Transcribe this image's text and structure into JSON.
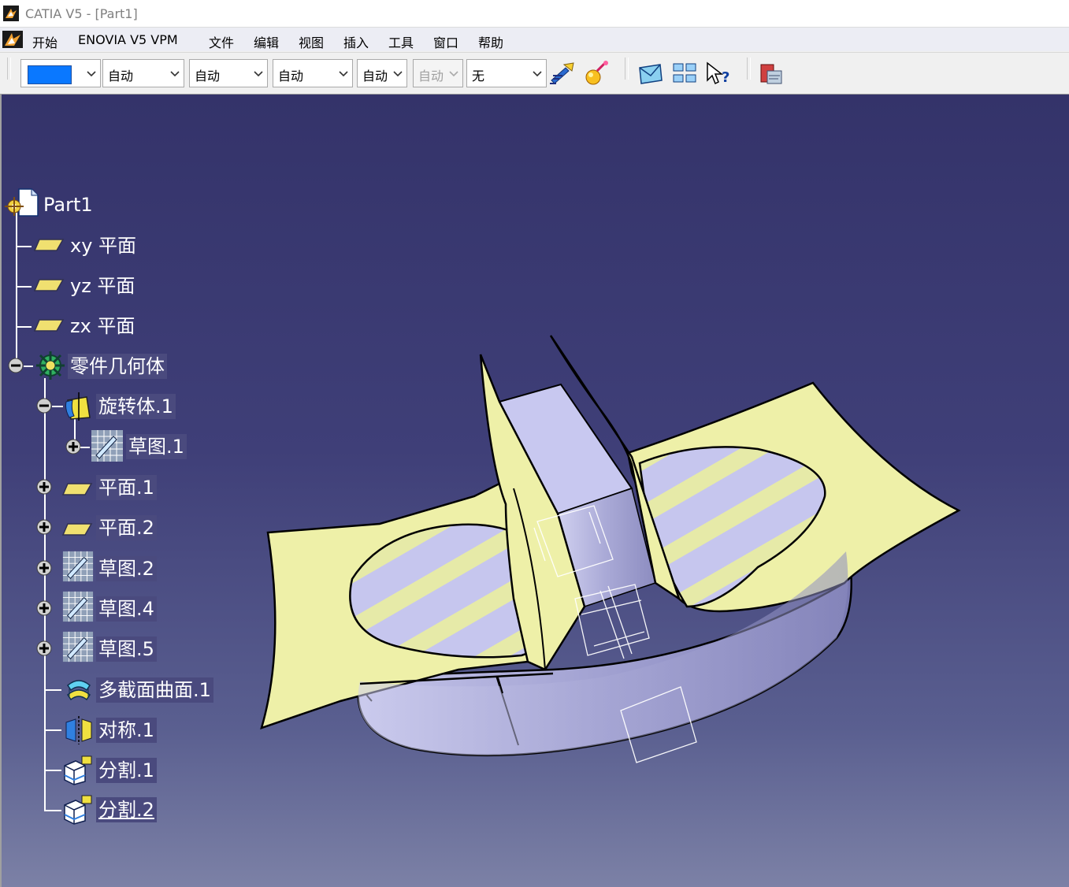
{
  "window": {
    "title": "CATIA V5 - [Part1]"
  },
  "menu": {
    "items": [
      "开始",
      "ENOVIA V5 VPM",
      "文件",
      "编辑",
      "视图",
      "插入",
      "工具",
      "窗口",
      "帮助"
    ]
  },
  "toolbar": {
    "color_value": "#0a78ff",
    "combos": [
      "自动",
      "自动",
      "自动",
      "自动",
      "自动",
      "无"
    ]
  },
  "tree": {
    "root": "Part1",
    "items": [
      "xy 平面",
      "yz 平面",
      "zx 平面",
      "零件几何体",
      "旋转体.1",
      "草图.1",
      "平面.1",
      "平面.2",
      "草图.2",
      "草图.4",
      "草图.5",
      "多截面曲面.1",
      "对称.1",
      "分割.1",
      "分割.2"
    ]
  },
  "colors": {
    "viewport_top": "#34336a",
    "viewport_bottom": "#7c81a6",
    "surface": "#eef0a8",
    "solid": "#c6c6ec"
  }
}
